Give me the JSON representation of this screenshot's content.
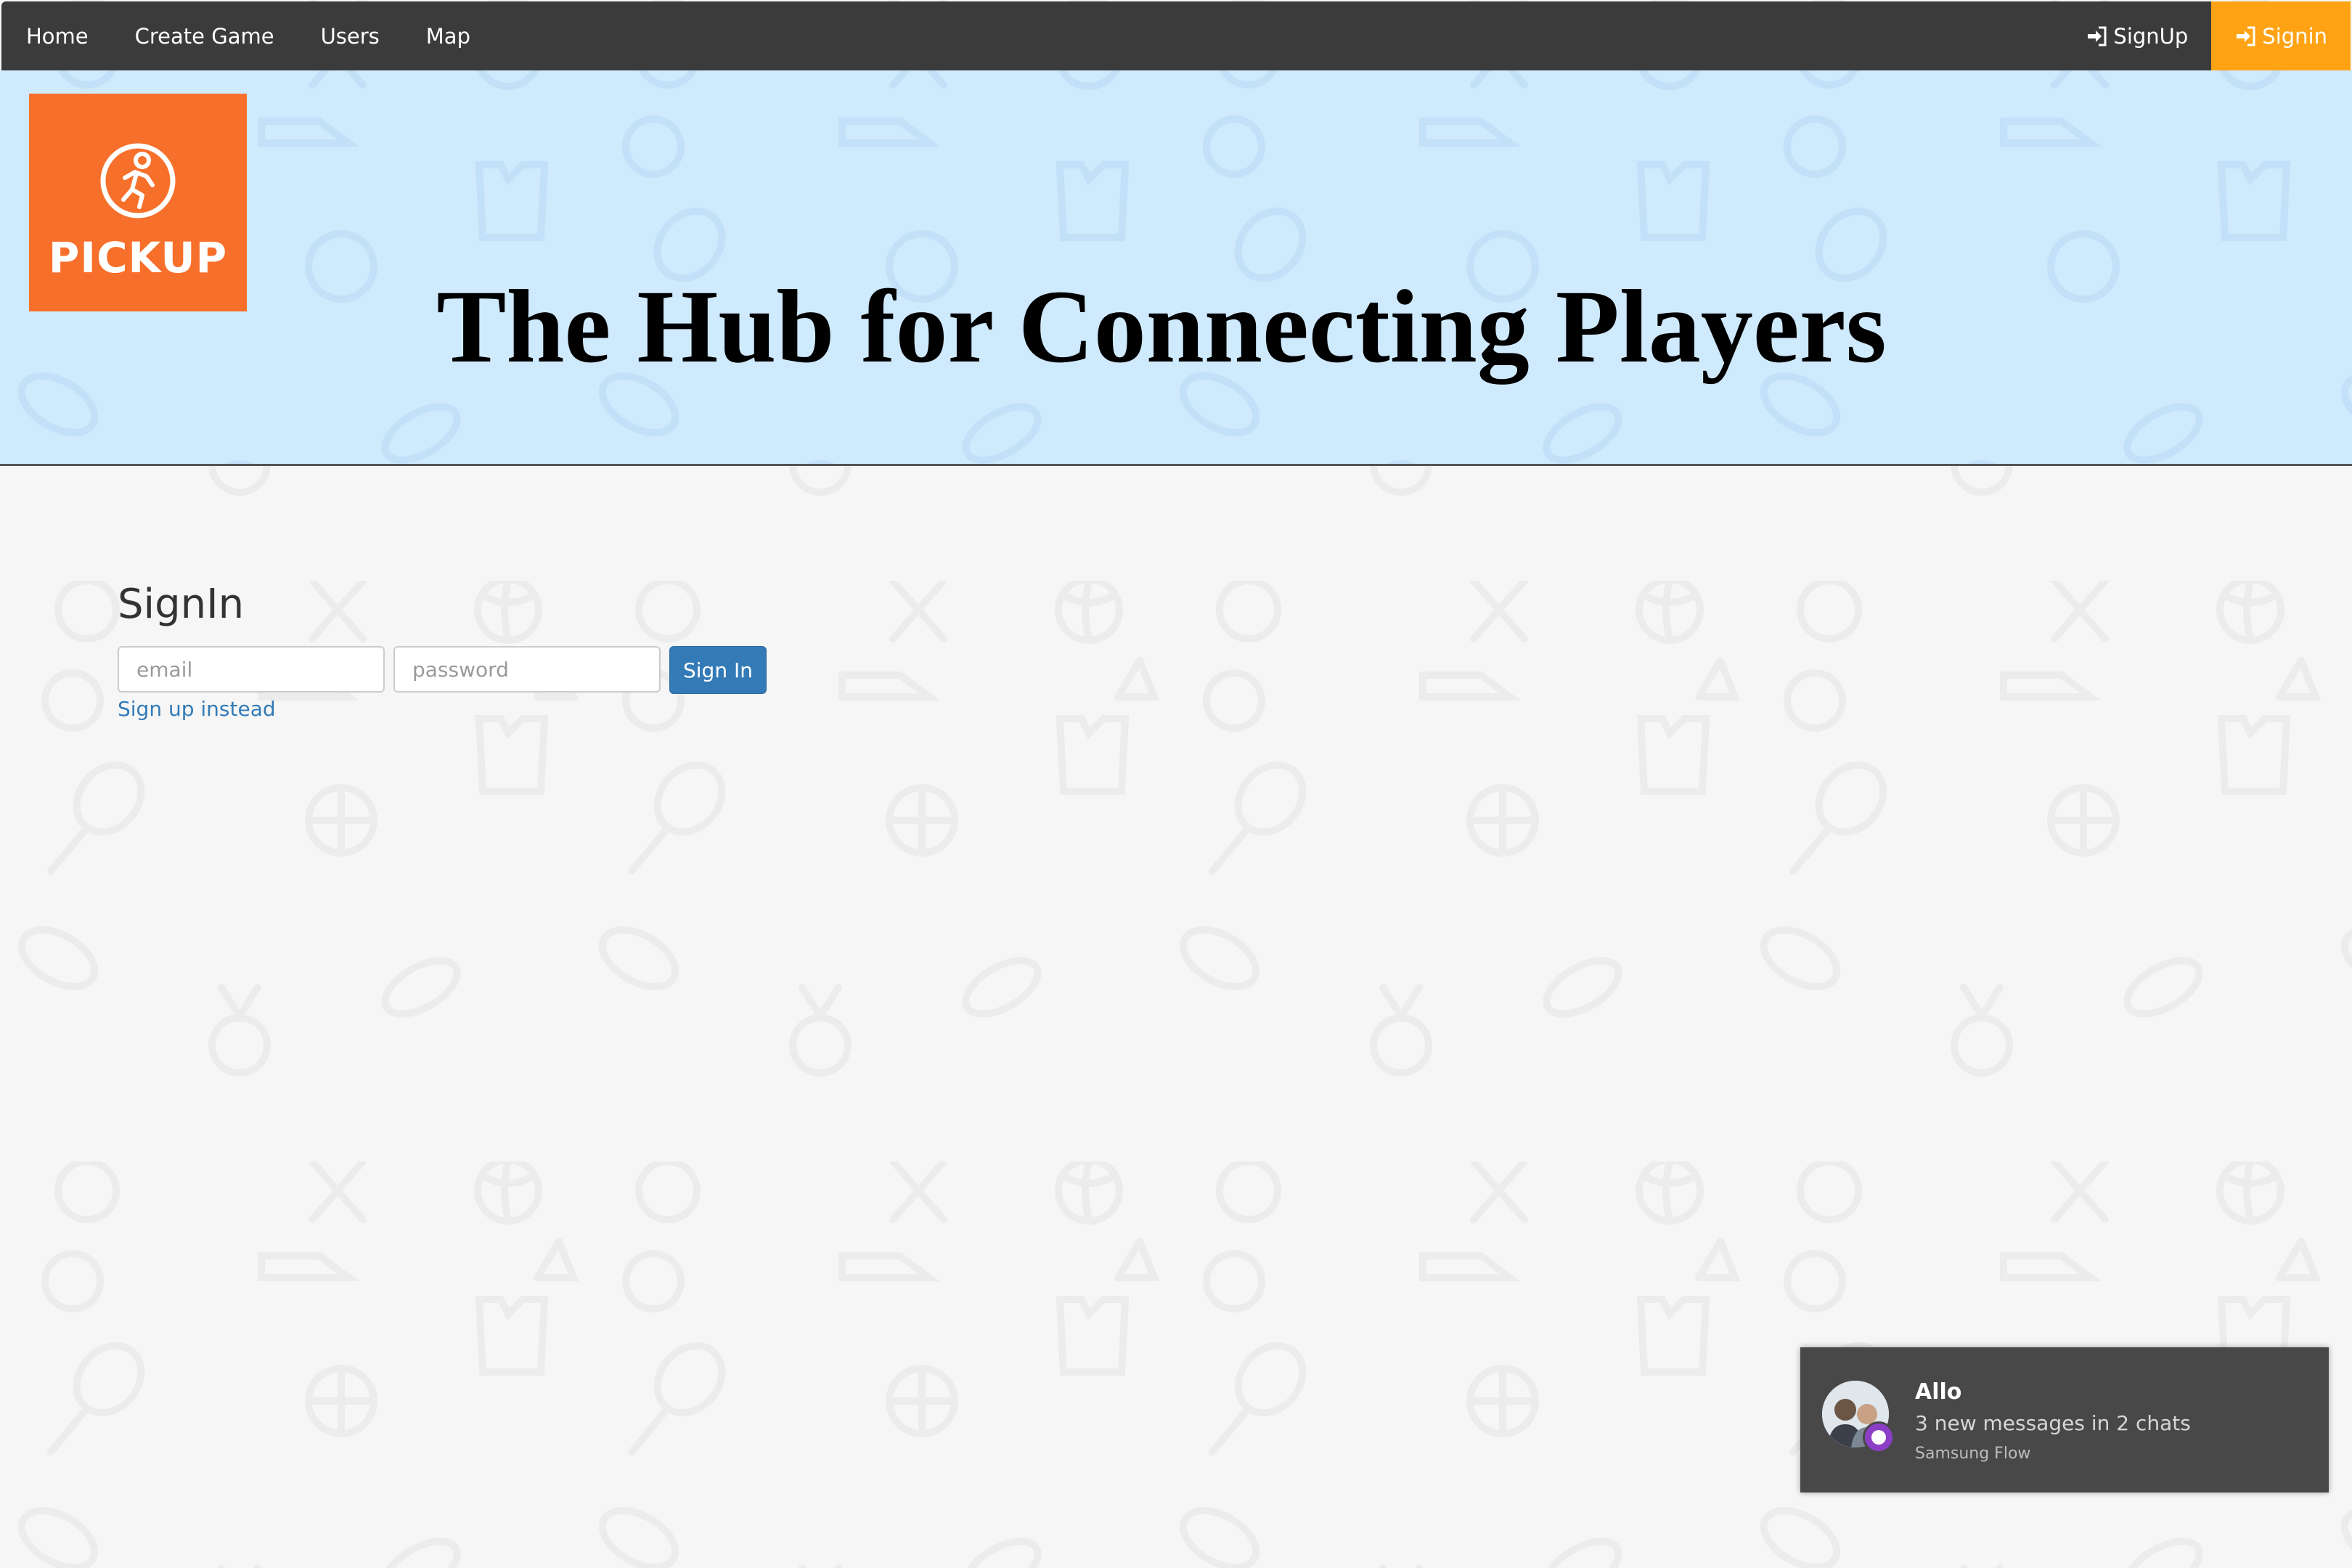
{
  "navbar": {
    "left_items": [
      {
        "label": "Home"
      },
      {
        "label": "Create Game"
      },
      {
        "label": "Users"
      },
      {
        "label": "Map"
      }
    ],
    "right_items": [
      {
        "label": "SignUp",
        "icon": "sign-in-icon"
      },
      {
        "label": "Signin",
        "icon": "sign-in-icon",
        "active": true
      }
    ],
    "background": "#3b3b3b",
    "active_color": "#ffa315"
  },
  "hero": {
    "logo_text": "PICKUP",
    "logo_icon": "runner-icon",
    "logo_color": "#f7702b",
    "title": "The Hub for Connecting Players",
    "background": "#cfe9fd"
  },
  "signin": {
    "heading": "SignIn",
    "email_placeholder": "email",
    "password_placeholder": "password",
    "button_label": "Sign In",
    "signup_link": "Sign up instead",
    "button_color": "#337ab7"
  },
  "notification": {
    "app": "Allo",
    "message": "3 new messages in 2 chats",
    "source": "Samsung Flow",
    "badge_color": "#8c3fc6"
  }
}
